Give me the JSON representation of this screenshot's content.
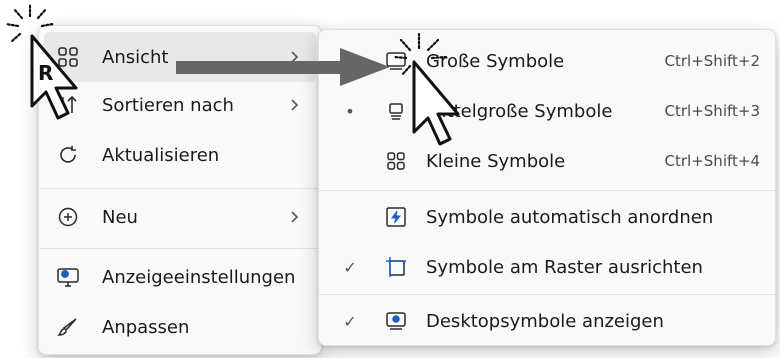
{
  "main_menu": {
    "items": [
      {
        "label": "Ansicht",
        "icon": "view-grid-icon",
        "has_submenu": true
      },
      {
        "label": "Sortieren nach",
        "icon": "sort-icon",
        "has_submenu": true
      },
      {
        "label": "Aktualisieren",
        "icon": "refresh-icon",
        "has_submenu": false
      },
      {
        "label": "Neu",
        "icon": "plus-circle-icon",
        "has_submenu": true
      },
      {
        "label": "Anzeigeeinstellungen",
        "icon": "display-settings-icon",
        "has_submenu": false
      },
      {
        "label": "Anpassen",
        "icon": "brush-icon",
        "has_submenu": false
      }
    ]
  },
  "sub_menu": {
    "items": [
      {
        "label": "Große Symbole",
        "shortcut": "Ctrl+Shift+2",
        "mark": "",
        "icon": "large-icons-icon"
      },
      {
        "label": "Mittelgroße Symbole",
        "shortcut": "Ctrl+Shift+3",
        "mark": "•",
        "icon": "medium-icons-icon"
      },
      {
        "label": "Kleine Symbole",
        "shortcut": "Ctrl+Shift+4",
        "mark": "",
        "icon": "small-icons-icon"
      },
      {
        "label": "Symbole automatisch anordnen",
        "shortcut": "",
        "mark": "",
        "icon": "auto-arrange-icon"
      },
      {
        "label": "Symbole am Raster ausrichten",
        "shortcut": "",
        "mark": "✓",
        "icon": "align-grid-icon"
      },
      {
        "label": "Desktopsymbole anzeigen",
        "shortcut": "",
        "mark": "✓",
        "icon": "show-desktop-icons-icon"
      }
    ]
  },
  "cursor": {
    "click_badge": "R"
  },
  "colors": {
    "menu_bg": "#f9f9f9",
    "hover_bg": "#e8e8e8",
    "arrow": "#666666",
    "accent": "#1f5fbf"
  }
}
